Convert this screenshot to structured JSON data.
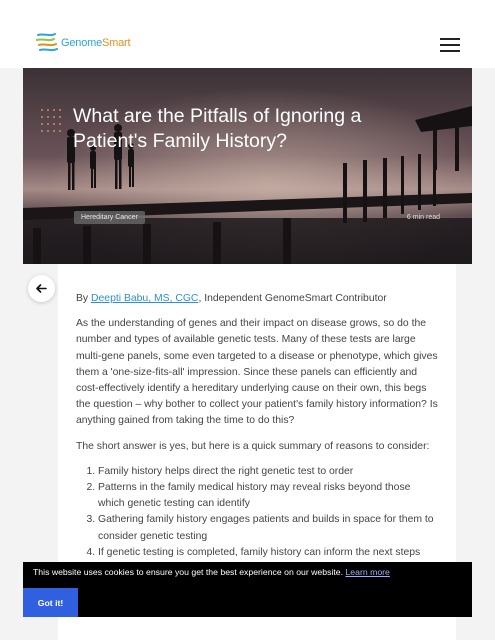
{
  "brand": {
    "name_part1": "Genome",
    "name_part2": "Smart",
    "logo_icon": "dna-strands-icon"
  },
  "header": {
    "menu_icon": "hamburger-menu-icon"
  },
  "hero": {
    "title": "What are the Pitfalls of Ignoring a Patient's Family History?",
    "tag": "Hereditary Cancer",
    "read_time": "6 min read"
  },
  "article": {
    "byline_prefix": "By ",
    "author": "Deepti Babu, MS, CGC",
    "byline_suffix": ", Independent GenomeSmart Contributor",
    "paragraph1": "As the understanding of genes and their impact on disease grows, so do the number and types of available genetic tests. Many of these tests are large multi-gene panels, some even targeted to a disease or phenotype, which gives them a 'one-size-fits-all' impression. Since these panels can efficiently and cost-effectively identify a hereditary underlying cause on their own, this begs the question – why bother to collect your patient's family history information? Is anything gained from taking the time to do this?",
    "paragraph2": "The short answer is yes, but here is a quick summary of reasons to consider:",
    "reasons": [
      "Family history helps direct the right genetic test to order",
      "Patterns in the family medical history may reveal risks beyond those which genetic testing can identify",
      "Gathering family history engages patients and builds in space for them to consider genetic testing",
      "If genetic testing is completed, family history can inform the next steps"
    ]
  },
  "cookie": {
    "message": "This website uses cookies to ensure you get the best experience on our website.",
    "learn_more": "Learn more",
    "button": "Got it!"
  }
}
